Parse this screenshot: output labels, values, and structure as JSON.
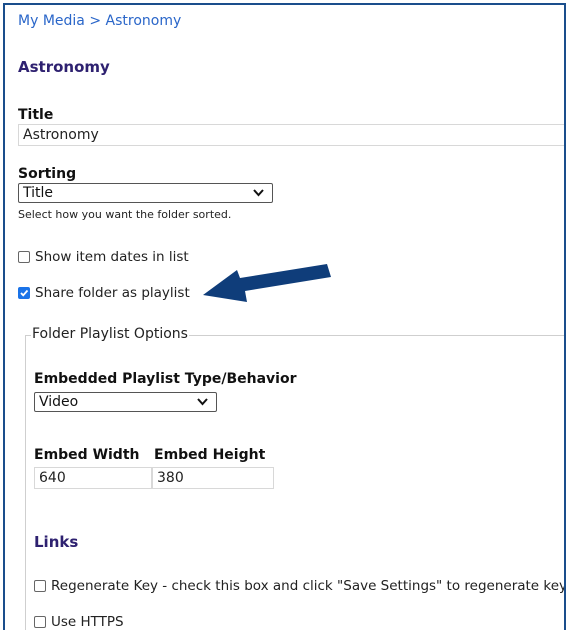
{
  "breadcrumb": {
    "root": "My Media",
    "separator": ">",
    "current": "Astronomy"
  },
  "page_title": "Astronomy",
  "title_field": {
    "label": "Title",
    "value": "Astronomy"
  },
  "sorting": {
    "label": "Sorting",
    "selected": "Title",
    "hint": "Select how you want the folder sorted."
  },
  "checkboxes": {
    "show_dates": {
      "label": "Show item dates in list",
      "checked": false
    },
    "share_playlist": {
      "label": "Share folder as playlist",
      "checked": true
    }
  },
  "playlist_options": {
    "legend": "Folder Playlist Options",
    "type_label": "Embedded Playlist Type/Behavior",
    "type_selected": "Video",
    "width_label": "Embed Width",
    "width_value": "640",
    "height_label": "Embed Height",
    "height_value": "380"
  },
  "links": {
    "heading": "Links",
    "regen_label": "Regenerate Key - check this box and click \"Save Settings\" to regenerate key",
    "https_label": "Use HTTPS"
  },
  "colors": {
    "accent_blue": "#2a66c9",
    "heading_purple": "#2e2170",
    "arrow": "#0f3d7a",
    "checkbox": "#1a73e8"
  }
}
